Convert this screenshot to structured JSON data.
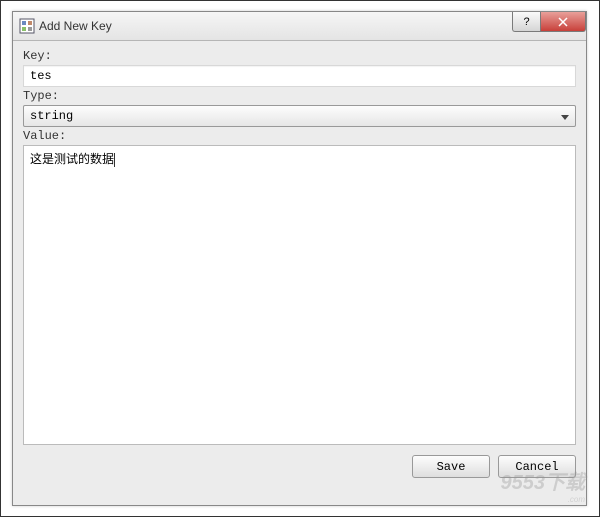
{
  "window": {
    "title": "Add New Key",
    "help_symbol": "?",
    "close_symbol": "X"
  },
  "form": {
    "key_label": "Key:",
    "key_value": "tes",
    "type_label": "Type:",
    "type_value": "string",
    "value_label": "Value:",
    "value_text": "这是测试的数据"
  },
  "buttons": {
    "save": "Save",
    "cancel": "Cancel"
  },
  "watermark": {
    "main": "9553下载",
    "sub": ".com"
  }
}
